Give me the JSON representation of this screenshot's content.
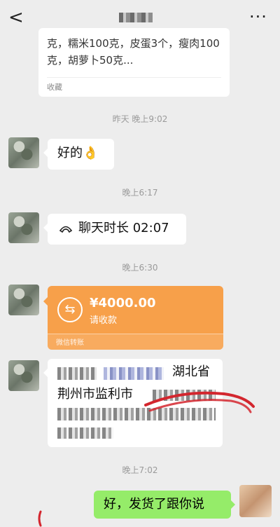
{
  "header": {
    "back": "<",
    "more": "···"
  },
  "card": {
    "text": "克，糯米100克，皮蛋3个，瘦肉100克，胡萝卜50克...",
    "footer": "收藏"
  },
  "times": [
    "昨天 晚上9:02",
    "晚上6:17",
    "晚上6:30",
    "晚上7:02"
  ],
  "messages": {
    "ok": "好的👌",
    "call": "聊天时长 02:07",
    "call_icon": "phone-icon",
    "transfer_amount": "¥4000.00",
    "transfer_sub": "请收款",
    "transfer_footer": "微信转账",
    "addr_visible": "湖北省",
    "addr_line2": "荆州市监利市",
    "reply": "好，发货了跟你说"
  },
  "colors": {
    "background": "#ededed",
    "transfer": "#f7a04a",
    "self_bubble": "#95ec69"
  }
}
